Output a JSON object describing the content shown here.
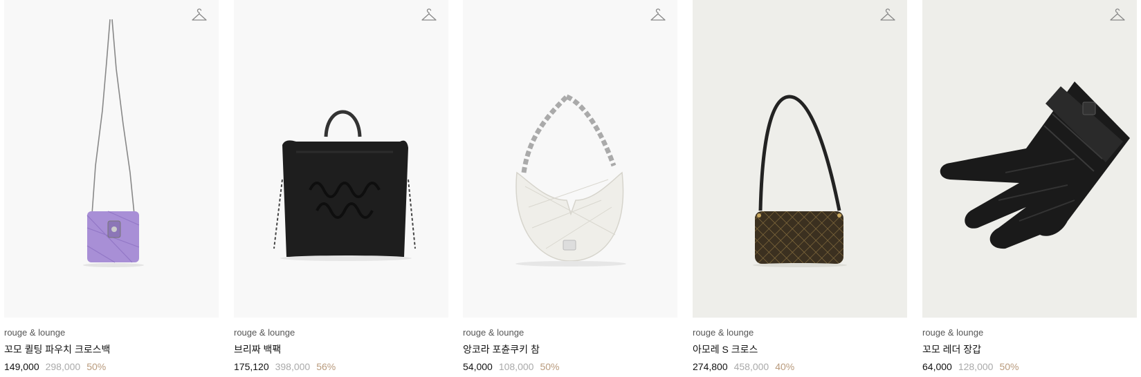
{
  "products": [
    {
      "brand": "rouge & lounge",
      "name": "꼬모 퀼팅 파우치 크로스백",
      "price": "149,000",
      "original_price": "298,000",
      "discount": "50%",
      "image": "lavender-quilted-crossbody-bag"
    },
    {
      "brand": "rouge & lounge",
      "name": "브리짜 백팩",
      "price": "175,120",
      "original_price": "398,000",
      "discount": "56%",
      "image": "black-drawstring-backpack"
    },
    {
      "brand": "rouge & lounge",
      "name": "앙코라 포츈쿠키 참",
      "price": "54,000",
      "original_price": "108,000",
      "discount": "50%",
      "image": "white-quilted-fortune-cookie-bag"
    },
    {
      "brand": "rouge & lounge",
      "name": "아모레 S 크로스",
      "price": "274,800",
      "original_price": "458,000",
      "discount": "40%",
      "image": "brown-monogram-shoulder-bag"
    },
    {
      "brand": "rouge & lounge",
      "name": "꼬모 레더 장갑",
      "price": "64,000",
      "original_price": "128,000",
      "discount": "50%",
      "image": "black-leather-gloves"
    }
  ],
  "icons": {
    "fitting": "hanger-icon"
  },
  "colors": {
    "price": "#111111",
    "original_price": "#aaaaaa",
    "discount": "#b99b7d",
    "thumb_bg": "#f8f8f8",
    "thumb_bg_alt": "#eeeeea"
  }
}
